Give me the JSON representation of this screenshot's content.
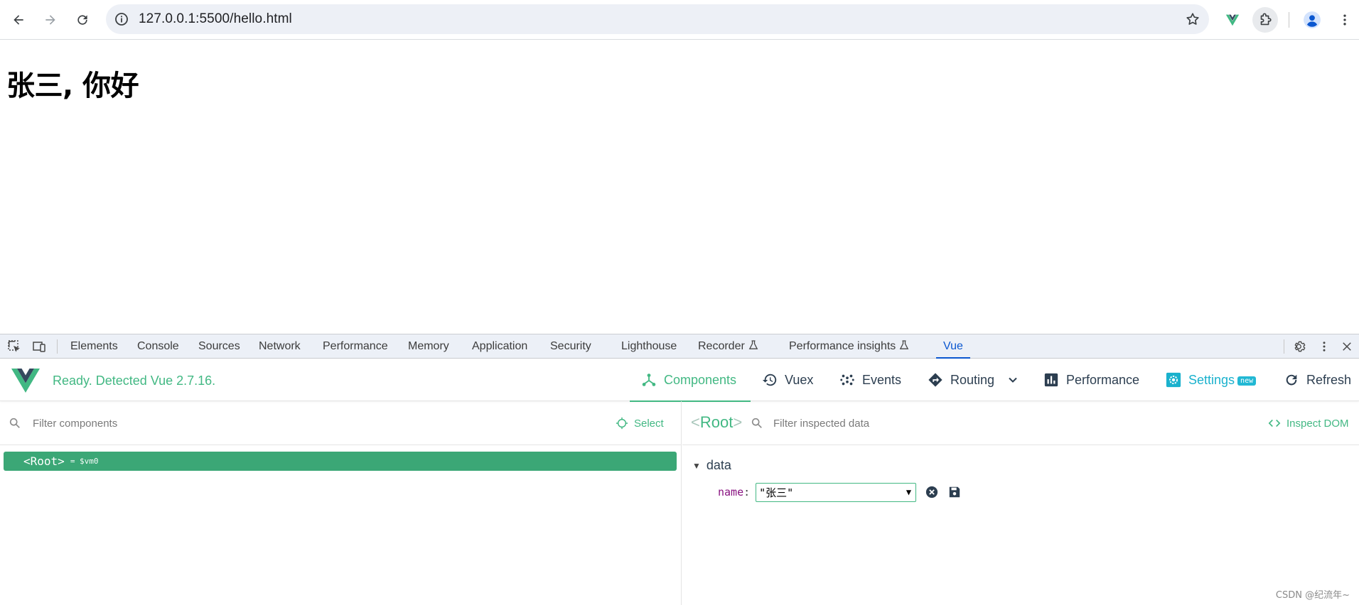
{
  "browser": {
    "url": "127.0.0.1:5500/hello.html",
    "icons": [
      "back-arrow-icon",
      "forward-arrow-icon",
      "reload-icon",
      "site-info-icon",
      "star-icon",
      "vue-extension-icon",
      "puzzle-extensions-icon",
      "profile-avatar-icon"
    ]
  },
  "page": {
    "greeting": "张三, 你好"
  },
  "devtools": {
    "tabs": [
      {
        "label": "Elements"
      },
      {
        "label": "Console"
      },
      {
        "label": "Sources"
      },
      {
        "label": "Network"
      },
      {
        "label": "Performance"
      },
      {
        "label": "Memory"
      },
      {
        "label": "Application"
      },
      {
        "label": "Security"
      },
      {
        "label": "Lighthouse"
      },
      {
        "label": "Recorder"
      },
      {
        "label": "Performance insights"
      },
      {
        "label": "Vue"
      }
    ],
    "active_tab": "Vue",
    "active_color": "#0b57d0"
  },
  "vue": {
    "status": "Ready. Detected Vue 2.7.16.",
    "brand_color": "#42b883",
    "nav": {
      "components": "Components",
      "vuex": "Vuex",
      "events": "Events",
      "routing": "Routing",
      "performance": "Performance",
      "settings": "Settings",
      "settings_badge": "new",
      "refresh": "Refresh"
    },
    "left": {
      "filter_placeholder": "Filter components",
      "select_label": "Select",
      "root_tag_open": "<",
      "root_name": "Root",
      "root_tag_close": ">",
      "root_vm": "= $vm0"
    },
    "right": {
      "title_open": "<",
      "title_name": "Root",
      "title_close": ">",
      "filter_placeholder": "Filter inspected data",
      "inspect_dom_label": "Inspect DOM",
      "section": "data",
      "prop_key": "name",
      "prop_colon": ":",
      "prop_value": "\"张三\""
    }
  },
  "watermark": "CSDN @纪流年~"
}
